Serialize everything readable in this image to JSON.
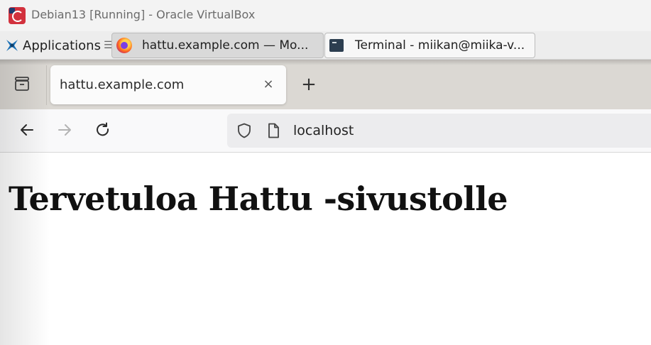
{
  "vbox": {
    "title": "Debian13 [Running] - Oracle VirtualBox"
  },
  "panel": {
    "applications_label": "Applications",
    "applications_separator": "☰",
    "tasks": [
      {
        "label": "hattu.example.com — Mo...",
        "icon": "firefox-icon",
        "active": true
      },
      {
        "label": "Terminal - miikan@miika-v...",
        "icon": "terminal-icon",
        "active": false
      }
    ]
  },
  "browser": {
    "tabs": [
      {
        "title": "hattu.example.com",
        "close": "×"
      }
    ],
    "new_tab": "+",
    "urlbar": {
      "url": "localhost"
    },
    "nav": {
      "back_icon": "arrow-left-icon",
      "forward_icon": "arrow-right-icon",
      "reload_icon": "reload-icon"
    }
  },
  "page": {
    "heading": "Tervetuloa Hattu -sivustolle"
  },
  "colors": {
    "tabstrip_bg": "#dbd8d3",
    "toolbar_bg": "#f9f9fa",
    "urlbar_bg": "#ececee",
    "vbox_icon": "#d2313d"
  }
}
